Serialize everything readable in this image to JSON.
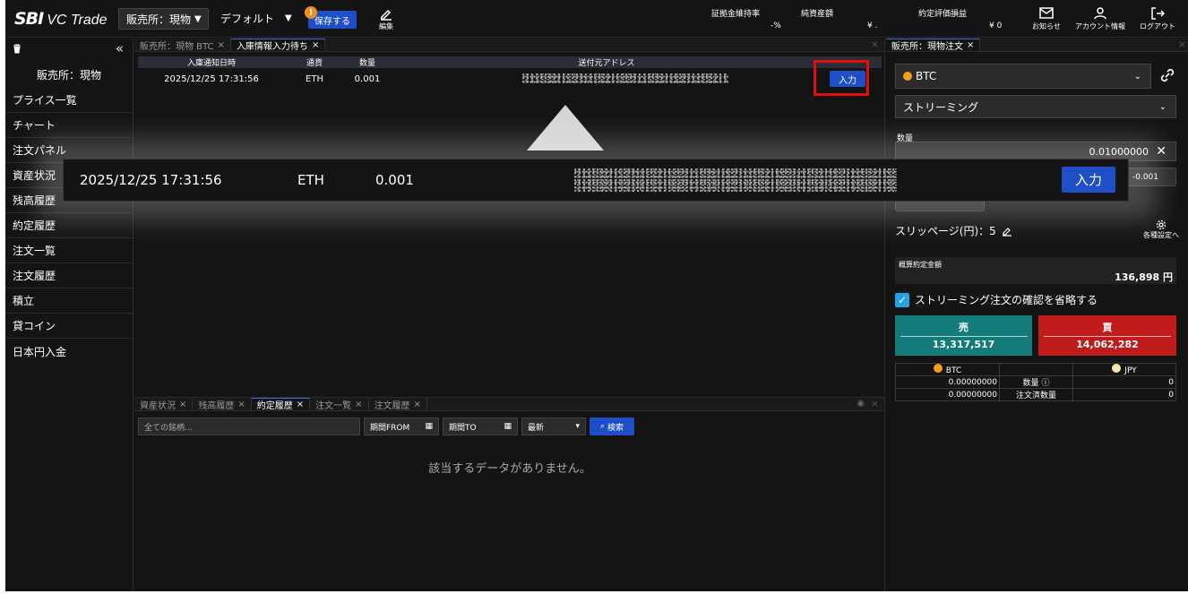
{
  "header": {
    "logo_main": "SBI",
    "logo_sub": "VC Trade",
    "exchange_select": "販売所：現物",
    "layout_select": "デフォルト",
    "save_badge": "!",
    "save_label": "保存する",
    "edit_label": "編集",
    "stats": [
      {
        "label": "証拠金維持率",
        "value": "-%"
      },
      {
        "label": "純資産額",
        "value": "¥ ."
      },
      {
        "label": "約定評価損益",
        "value": "¥ 0"
      }
    ],
    "icons": [
      {
        "label": "お知らせ",
        "icon": "mail-icon"
      },
      {
        "label": "アカウント情報",
        "icon": "user-icon"
      },
      {
        "label": "ログアウト",
        "icon": "logout-icon"
      }
    ]
  },
  "sidebar": {
    "collapse": "«",
    "title": "販売所：現物",
    "items": [
      "プライス一覧",
      "チャート",
      "注文パネル",
      "資産状況",
      "残高履歴",
      "約定履歴",
      "注文一覧",
      "注文履歴",
      "積立",
      "貸コイン",
      "日本円入金"
    ]
  },
  "top_pane": {
    "tabs": [
      {
        "label": "販売所：現物 BTC",
        "active": false
      },
      {
        "label": "入庫情報入力待ち",
        "active": true
      }
    ],
    "columns": [
      "入庫通知日時",
      "通貨",
      "数量",
      "送付元アドレス"
    ],
    "rows": [
      {
        "date": "2025/12/25 17:31:56",
        "currency": "ETH",
        "qty": "0.001",
        "action": "入力"
      }
    ]
  },
  "zoom": {
    "date": "2025/12/25 17:31:56",
    "currency": "ETH",
    "qty": "0.001",
    "action": "入力"
  },
  "bottom_pane": {
    "tabs": [
      {
        "label": "資産状況",
        "active": false
      },
      {
        "label": "残高履歴",
        "active": false
      },
      {
        "label": "約定履歴",
        "active": true
      },
      {
        "label": "注文一覧",
        "active": false
      },
      {
        "label": "注文履歴",
        "active": false
      }
    ],
    "filter_placeholder": "全ての銘柄...",
    "period_from": "期間FROM",
    "period_to": "期間TO",
    "sort": "最新",
    "search": "検索",
    "no_data": "該当するデータがありません。"
  },
  "order_panel": {
    "tab": "販売所：現物注文",
    "coin": "BTC",
    "mode": "ストリーミング",
    "qty_label": "数量",
    "qty_value": "0.01000000",
    "qty_step": "-0.001",
    "slippage": "スリッページ(円)：5",
    "settings": "各種設定へ",
    "est_label": "概算約定金額",
    "est_value": "136,898 円",
    "confirm_label": "ストリーミング注文の確認を省略する",
    "sell_label": "売",
    "sell_price": "13,317,517",
    "buy_label": "買",
    "buy_price": "14,062,282",
    "balance": {
      "coin": "BTC",
      "fiat": "JPY",
      "qty_label": "数量",
      "ordered_label": "注文済数量",
      "btc_qty": "0.00000000",
      "btc_ordered": "0.00000000",
      "jpy_qty": "0",
      "jpy_ordered": "0"
    }
  },
  "colors": {
    "accent_blue": "#1f4fc7",
    "sell_teal": "#147b7b",
    "buy_red": "#c11b1b",
    "highlight_red": "#e10e0e"
  }
}
